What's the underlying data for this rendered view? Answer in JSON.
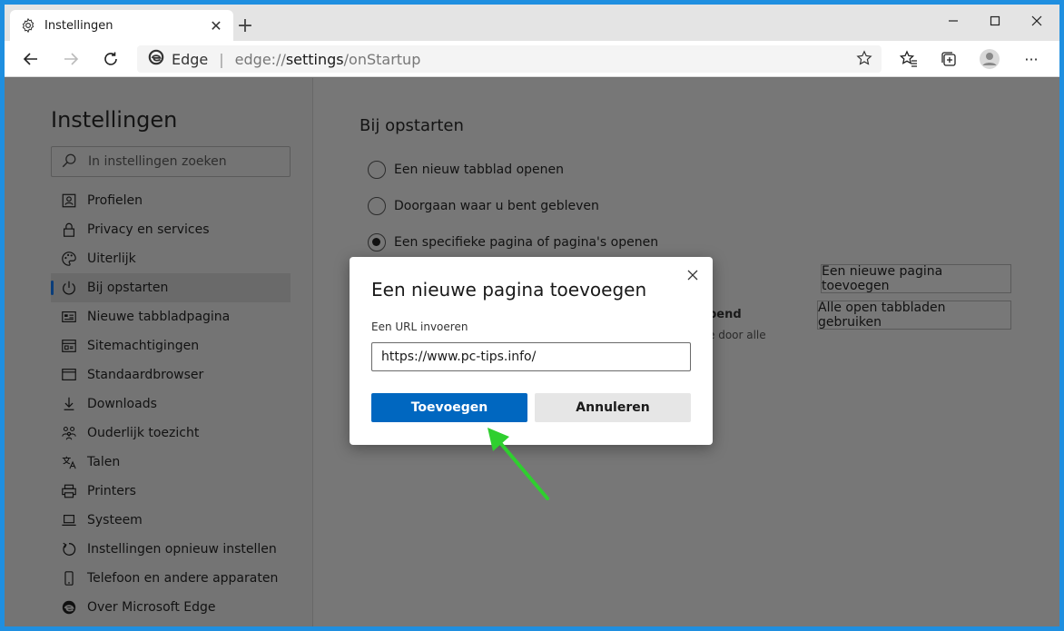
{
  "tab": {
    "title": "Instellingen"
  },
  "address": {
    "brand": "Edge",
    "url_prefix": "edge://",
    "url_bold": "settings",
    "url_suffix": "/onStartup"
  },
  "sidebar": {
    "title": "Instellingen",
    "search_placeholder": "In instellingen zoeken",
    "items": [
      {
        "label": "Profielen",
        "icon": "profile-icon"
      },
      {
        "label": "Privacy en services",
        "icon": "lock-icon"
      },
      {
        "label": "Uiterlijk",
        "icon": "palette-icon"
      },
      {
        "label": "Bij opstarten",
        "icon": "power-icon"
      },
      {
        "label": "Nieuwe tabbladpagina",
        "icon": "newtab-page-icon"
      },
      {
        "label": "Sitemachtigingen",
        "icon": "site-permissions-icon"
      },
      {
        "label": "Standaardbrowser",
        "icon": "browser-icon"
      },
      {
        "label": "Downloads",
        "icon": "download-icon"
      },
      {
        "label": "Ouderlijk toezicht",
        "icon": "family-icon"
      },
      {
        "label": "Talen",
        "icon": "language-icon"
      },
      {
        "label": "Printers",
        "icon": "printer-icon"
      },
      {
        "label": "Systeem",
        "icon": "laptop-icon"
      },
      {
        "label": "Instellingen opnieuw instellen",
        "icon": "reset-icon"
      },
      {
        "label": "Telefoon en andere apparaten",
        "icon": "phone-icon"
      },
      {
        "label": "Over Microsoft Edge",
        "icon": "edge-logo-icon"
      }
    ]
  },
  "main": {
    "title": "Bij opstarten",
    "options": [
      {
        "label": "Een nieuw tabblad openen",
        "selected": false
      },
      {
        "label": "Doorgaan waar u bent gebleven",
        "selected": false
      },
      {
        "label": "Een specifieke pagina of pagina's openen",
        "selected": true
      }
    ],
    "add_page_button": "Een nieuwe pagina toevoegen",
    "use_all_tabs_button": "Alle open tabbladen gebruiken",
    "partial_heading": "pend",
    "partial_text": "e door alle"
  },
  "dialog": {
    "title": "Een nieuwe pagina toevoegen",
    "url_label": "Een URL invoeren",
    "url_value": "https://www.pc-tips.info/",
    "add_button": "Toevoegen",
    "cancel_button": "Annuleren"
  },
  "colors": {
    "accent": "#0067c0",
    "arrow": "#2fcf2f",
    "frame": "#1f8fe0"
  }
}
